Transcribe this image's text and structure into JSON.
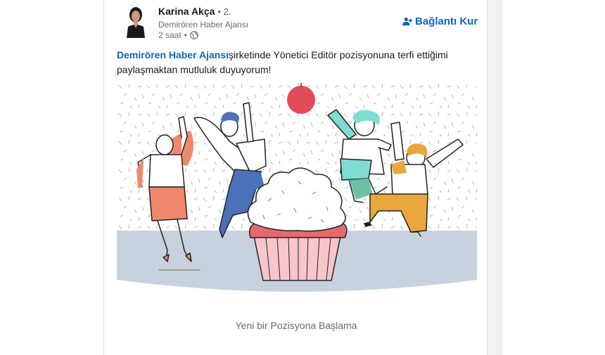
{
  "post": {
    "author": {
      "name": "Karina Akça",
      "degree": "• 2.",
      "headline": "Demirören Haber Ajansı",
      "time": "2 saat",
      "time_separator": "•",
      "visibility_icon": "globe-icon"
    },
    "connect_button": {
      "icon": "add-person-icon",
      "label": "Bağlantı Kur"
    },
    "text": {
      "company_mention": "Demirören Haber Ajansı",
      "body": "şirketinde Yönetici Editör pozisyonuna terfi ettiğimi paylaşmaktan mutluluk duyuyorum!"
    },
    "celebration": {
      "image": "celebration-illustration",
      "caption": "Yeni bir Pozisyona Başlama"
    }
  },
  "colors": {
    "link_blue": "#0a66c2",
    "floor": "#c8d2de",
    "cupcake_cup": "#f7c5cb",
    "cupcake_frosting_base": "#e56b6f",
    "balloon": "#e24c5a",
    "orange_person": "#f0896b",
    "blue_person": "#4b72b9",
    "teal_person": "#7fdcd1",
    "yellow_person": "#e8a63d"
  }
}
